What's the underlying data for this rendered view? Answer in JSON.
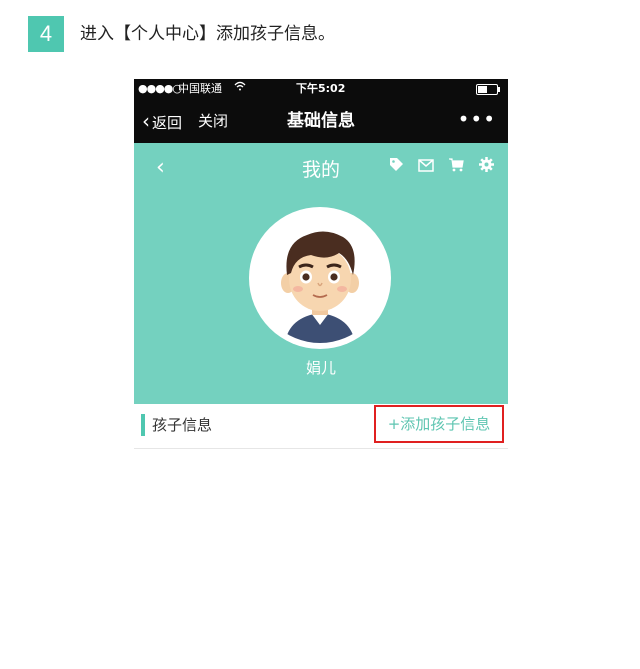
{
  "step": {
    "number": "4",
    "instruction": "进入【个人中心】添加孩子信息。"
  },
  "statusbar": {
    "signal": "●●●●○",
    "carrier": "中国联通",
    "wifi_icon": "wifi-icon",
    "time": "下午5:02",
    "battery_level": 0.5
  },
  "navbar": {
    "back_label": "返回",
    "close_label": "关闭",
    "title": "基础信息",
    "more_label": "•••"
  },
  "profile": {
    "back_glyph": "‹",
    "title": "我的",
    "icons": [
      "tag-icon",
      "mail-icon",
      "cart-icon",
      "gear-icon"
    ],
    "username": "娟儿"
  },
  "child_info": {
    "label": "孩子信息",
    "add_button": "+添加孩子信息"
  },
  "colors": {
    "accent": "#74d1bf",
    "badge": "#4fc7b0",
    "highlight": "#e02020",
    "nav": "#0c0c0c"
  }
}
